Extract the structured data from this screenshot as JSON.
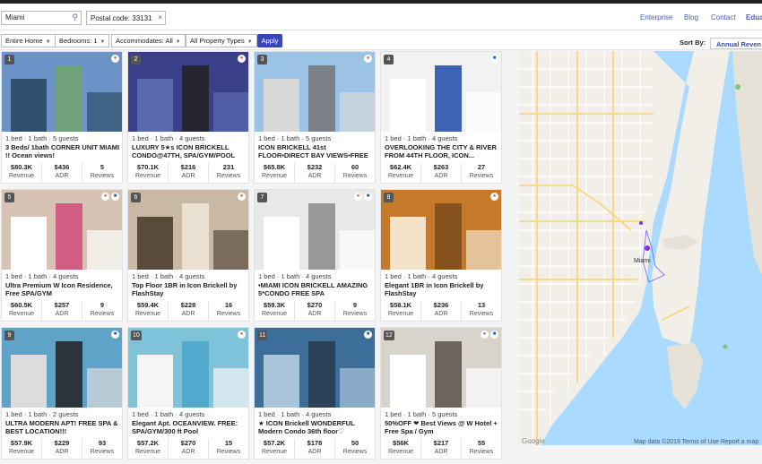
{
  "header": {
    "search_value": "Miami",
    "postal_chip": "Postal code: 33131",
    "nav": [
      "Enterprise",
      "Blog",
      "Contact",
      "Edua"
    ]
  },
  "filters": {
    "home_type": "Entire Home",
    "bedrooms": "Bedrooms: 1",
    "accommodates": "Accommodates: All",
    "property_types": "All Property Types",
    "apply_label": "Apply",
    "sort_label": "Sort By:",
    "sort_value": "Annual Reven"
  },
  "stat_labels": {
    "revenue": "Revenue",
    "adr": "ADR",
    "reviews": "Reviews"
  },
  "listings": [
    {
      "num": "1",
      "bed": "1 bed",
      "bath": "1 bath",
      "guests": "5 guests",
      "title": "3 Beds/ 1bath CORNER UNIT MIAMI !! Ocean views!",
      "revenue": "$80.3K",
      "adr": "$436",
      "reviews": "5",
      "badges": [
        "airbnb"
      ]
    },
    {
      "num": "2",
      "bed": "1 bed",
      "bath": "1 bath",
      "guests": "4 guests",
      "title": "LUXURY 5★s ICON BRICKELL CONDO@47TH, SPA/GYM/POOL",
      "revenue": "$70.1K",
      "adr": "$216",
      "reviews": "231",
      "badges": [
        "airbnb"
      ]
    },
    {
      "num": "3",
      "bed": "1 bed",
      "bath": "1 bath",
      "guests": "5 guests",
      "title": "ICON BRICKELL 41st FLOOR•DIRECT BAY VIEWS•FREE SPA",
      "revenue": "$65.8K",
      "adr": "$232",
      "reviews": "60",
      "badges": [
        "airbnb"
      ]
    },
    {
      "num": "4",
      "bed": "1 bed",
      "bath": "1 bath",
      "guests": "4 guests",
      "title": "OVERLOOKING THE CITY & RIVER FROM 44TH FLOOR, ICON...",
      "revenue": "$62.4K",
      "adr": "$263",
      "reviews": "27",
      "badges": [
        "booking"
      ]
    },
    {
      "num": "5",
      "bed": "1 bed",
      "bath": "1 bath",
      "guests": "4 guests",
      "title": "Ultra Premium W Icon Residence, Free SPA/GYM",
      "revenue": "$60.5K",
      "adr": "$257",
      "reviews": "9",
      "badges": [
        "airbnb",
        "booking"
      ]
    },
    {
      "num": "6",
      "bed": "1 bed",
      "bath": "1 bath",
      "guests": "4 guests",
      "title": "Top Floor 1BR in Icon Brickell by FlashStay",
      "revenue": "$59.4K",
      "adr": "$228",
      "reviews": "16",
      "badges": [
        "airbnb"
      ]
    },
    {
      "num": "7",
      "bed": "1 bed",
      "bath": "1 bath",
      "guests": "4 guests",
      "title": "•MIAMI ICON BRICKELL AMAZING 5*CONDO FREE SPA",
      "revenue": "$59.3K",
      "adr": "$270",
      "reviews": "9",
      "badges": [
        "airbnb",
        "booking"
      ]
    },
    {
      "num": "8",
      "bed": "1 bed",
      "bath": "1 bath",
      "guests": "4 guests",
      "title": "Elegant 1BR in Icon Brickell by FlashStay",
      "revenue": "$58.1K",
      "adr": "$236",
      "reviews": "13",
      "badges": [
        "airbnb"
      ]
    },
    {
      "num": "9",
      "bed": "1 bed",
      "bath": "1 bath",
      "guests": "2 guests",
      "title": "ULTRA MODERN APT! FREE SPA & BEST LOCATION!!!",
      "revenue": "$57.9K",
      "adr": "$229",
      "reviews": "93",
      "badges": [
        "booking"
      ]
    },
    {
      "num": "10",
      "bed": "1 bed",
      "bath": "1 bath",
      "guests": "4 guests",
      "title": "Elegant Apt. OCEANVIEW. FREE: SPA/GYM/300 ft Pool",
      "revenue": "$57.2K",
      "adr": "$270",
      "reviews": "15",
      "badges": [
        "airbnb"
      ]
    },
    {
      "num": "11",
      "bed": "1 bed",
      "bath": "1 bath",
      "guests": "4 guests",
      "title": "★ ICON Brickell WONDERFUL Modern Condo 36th floor♡",
      "revenue": "$57.2K",
      "adr": "$178",
      "reviews": "50",
      "badges": [
        "booking"
      ]
    },
    {
      "num": "12",
      "bed": "1 bed",
      "bath": "1 bath",
      "guests": "5 guests",
      "title": "50%OFF ❤ Best Views @ W Hotel + Free Spa / Gym",
      "revenue": "$56K",
      "adr": "$217",
      "reviews": "55",
      "badges": [
        "airbnb",
        "booking"
      ]
    }
  ],
  "map": {
    "city_label": "Miami",
    "attribution": "Map data ©2019 Terms of Use Report a map",
    "google": "Google"
  },
  "colors": {
    "accent": "#3948b8",
    "water": "#aadaff",
    "airbnb": "#e0565b",
    "booking": "#1f5fb8"
  }
}
